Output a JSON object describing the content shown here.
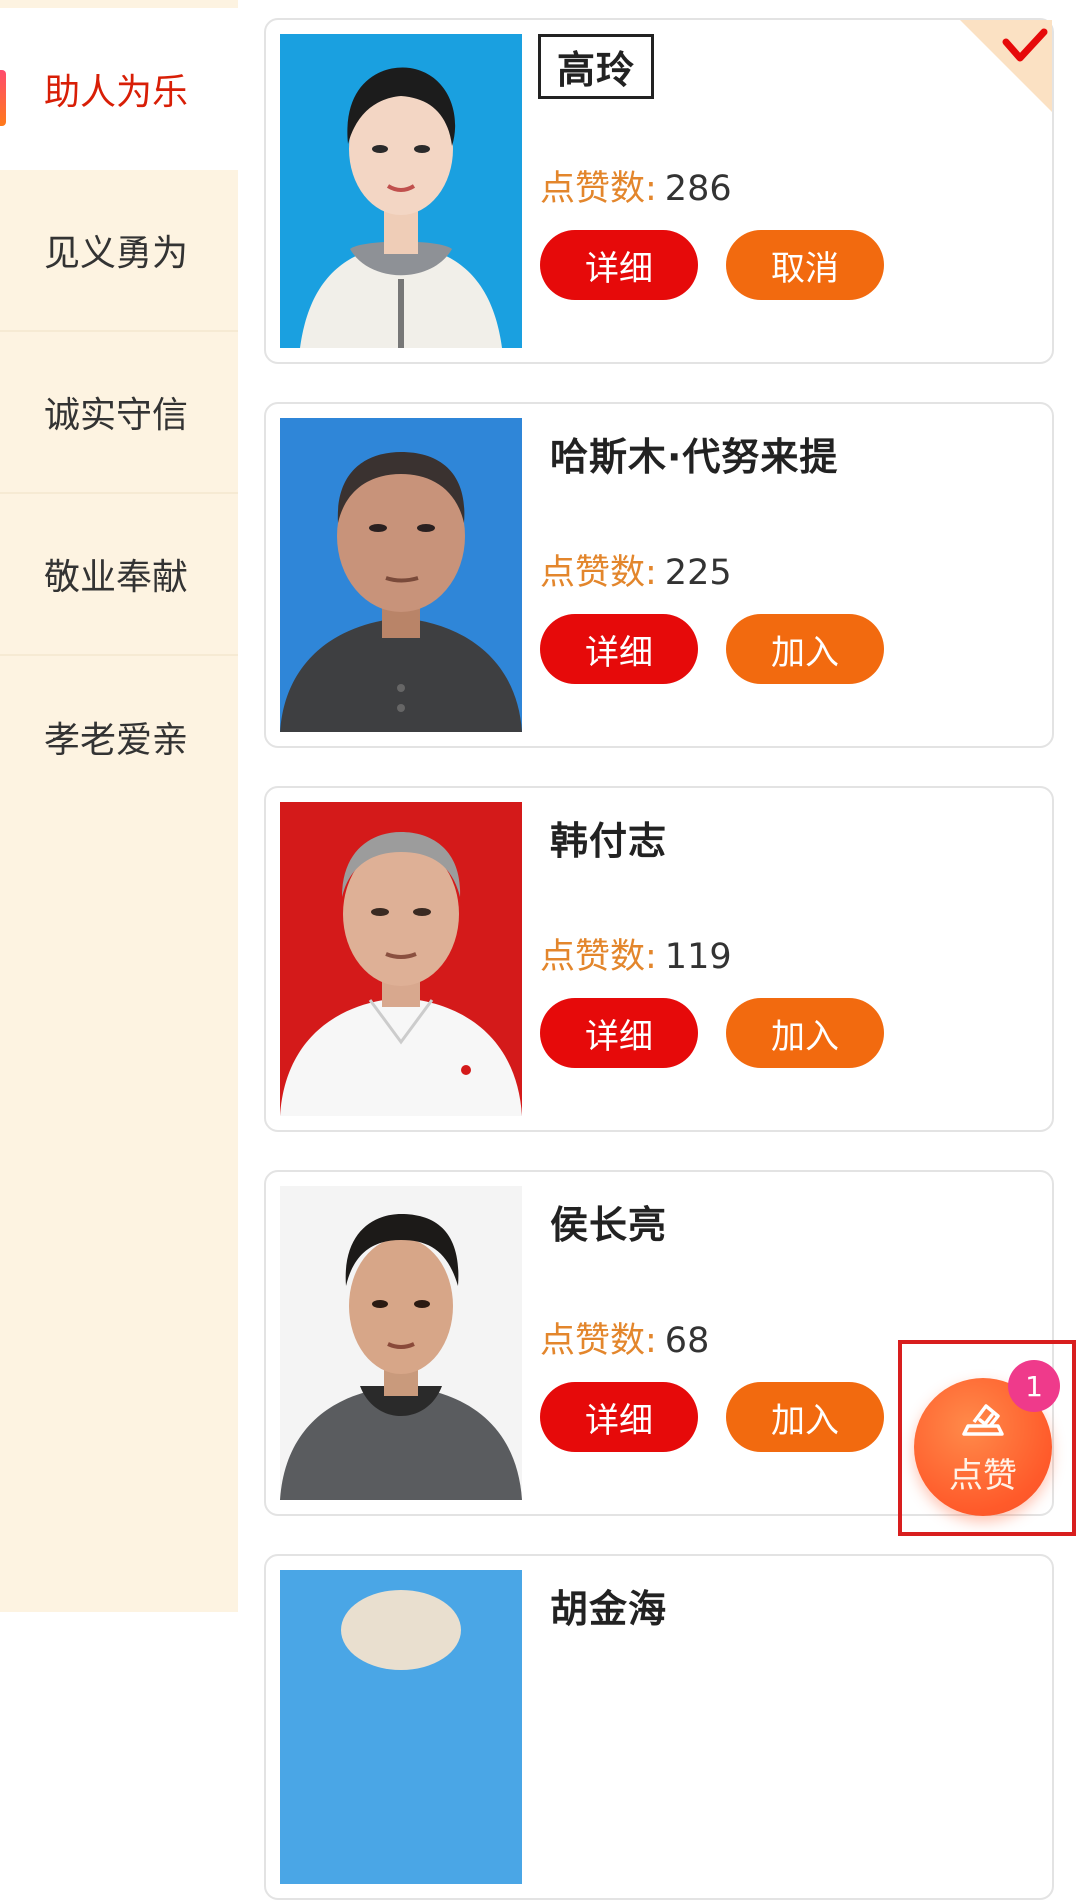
{
  "sidebar": {
    "items": [
      {
        "label": "助人为乐",
        "active": true
      },
      {
        "label": "见义勇为",
        "active": false
      },
      {
        "label": "诚实守信",
        "active": false
      },
      {
        "label": "敬业奉献",
        "active": false
      },
      {
        "label": "孝老爱亲",
        "active": false
      }
    ]
  },
  "cards": [
    {
      "name": "高玲",
      "likes_label": "点赞数:",
      "likes": "286",
      "detail_label": "详细",
      "action_label": "取消",
      "selected": true,
      "photo_bg": "#1aa0e0"
    },
    {
      "name": "哈斯木·代努来提",
      "likes_label": "点赞数:",
      "likes": "225",
      "detail_label": "详细",
      "action_label": "加入",
      "selected": false,
      "photo_bg": "#2f86d8"
    },
    {
      "name": "韩付志",
      "likes_label": "点赞数:",
      "likes": "119",
      "detail_label": "详细",
      "action_label": "加入",
      "selected": false,
      "photo_bg": "#d41a1a"
    },
    {
      "name": "侯长亮",
      "likes_label": "点赞数:",
      "likes": "68",
      "detail_label": "详细",
      "action_label": "加入",
      "selected": false,
      "photo_bg": "#f4f4f4"
    },
    {
      "name": "胡金海",
      "photo_bg": "#4aa6e6"
    }
  ],
  "fab": {
    "label": "点赞",
    "badge": "1"
  },
  "colors": {
    "accent_red": "#e60a0a",
    "accent_orange": "#f26a0f",
    "sidebar_bg": "#fdf3e1",
    "likes_label": "#e3862c"
  }
}
